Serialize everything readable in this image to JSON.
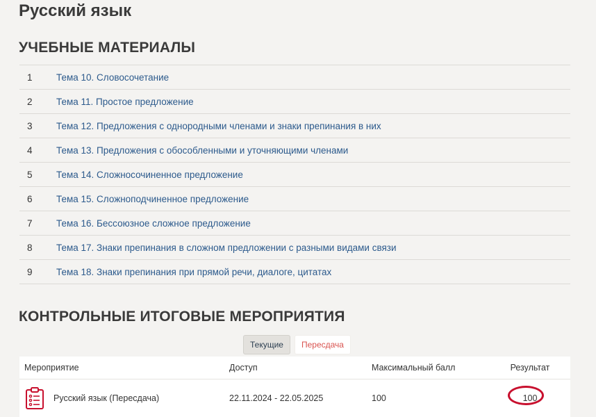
{
  "page": {
    "title": "Русский язык"
  },
  "materials": {
    "title": "УЧЕБНЫЕ МАТЕРИАЛЫ",
    "items": [
      {
        "num": "1",
        "label": "Тема 10. Словосочетание"
      },
      {
        "num": "2",
        "label": "Тема 11. Простое предложение"
      },
      {
        "num": "3",
        "label": "Тема 12. Предложения с однородными членами и знаки препинания в них"
      },
      {
        "num": "4",
        "label": "Тема 13. Предложения с обособленными и уточняющими членами"
      },
      {
        "num": "5",
        "label": "Тема 14. Сложносочиненное предложение"
      },
      {
        "num": "6",
        "label": "Тема 15. Сложноподчиненное предложение"
      },
      {
        "num": "7",
        "label": "Тема 16. Бессоюзное сложное предложение"
      },
      {
        "num": "8",
        "label": "Тема 17. Знаки препинания в сложном предложении с разными видами связи"
      },
      {
        "num": "9",
        "label": "Тема 18. Знаки препинания при прямой речи, диалоге, цитатах"
      }
    ]
  },
  "control": {
    "title": "КОНТРОЛЬНЫЕ ИТОГОВЫЕ МЕРОПРИЯТИЯ",
    "tabs": {
      "current": "Текущие",
      "retake": "Пересдача"
    },
    "table": {
      "headers": {
        "event": "Мероприятие",
        "access": "Доступ",
        "max_score": "Максимальный балл",
        "result": "Результат"
      },
      "rows": [
        {
          "event": "Русский язык (Пересдача)",
          "access": "22.11.2024 - 22.05.2025",
          "max_score": "100",
          "result": "100"
        }
      ]
    },
    "colors": {
      "highlight_circle": "#c8102e",
      "icon": "#c8102e",
      "link": "#2c5a8c"
    }
  }
}
